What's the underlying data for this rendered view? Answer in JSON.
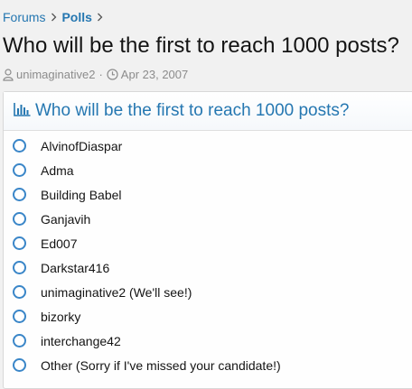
{
  "breadcrumb": {
    "items": [
      "Forums",
      "Polls"
    ]
  },
  "thread": {
    "title": "Who will be the first to reach 1000 posts?",
    "author": "unimaginative2",
    "separator": "·",
    "date": "Apr 23, 2007"
  },
  "poll": {
    "question": "Who will be the first to reach 1000 posts?",
    "options": [
      "AlvinofDiaspar",
      "Adma",
      "Building Babel",
      "Ganjavih",
      "Ed007",
      "Darkstar416",
      "unimaginative2 (We'll see!)",
      "bizorky",
      "interchange42",
      "Other (Sorry if I've missed your candidate!)"
    ]
  },
  "colors": {
    "link": "#2577b1",
    "radio": "#3a86c8",
    "muted": "#8c8c8c"
  }
}
